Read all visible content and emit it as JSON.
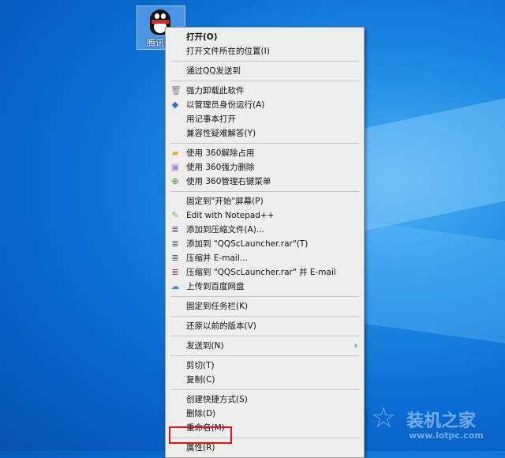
{
  "desktop": {
    "icon_label": "腾讯QQ"
  },
  "menu": {
    "groups": [
      [
        {
          "label": "打开(O)",
          "bold": true
        },
        {
          "label": "打开文件所在的位置(I)"
        }
      ],
      [
        {
          "label": "通过QQ发送到"
        }
      ],
      [
        {
          "label": "强力卸载此软件",
          "icon": "trash-icon"
        },
        {
          "label": "以管理员身份运行(A)",
          "icon": "uac-shield-icon"
        },
        {
          "label": "用记事本打开"
        },
        {
          "label": "兼容性疑难解答(Y)"
        }
      ],
      [
        {
          "label": "使用 360解除占用",
          "icon": "folder-unlock-icon"
        },
        {
          "label": "使用 360强力删除",
          "icon": "shredder-icon"
        },
        {
          "label": "使用 360管理右键菜单",
          "icon": "360-icon"
        }
      ],
      [
        {
          "label": "固定到\"开始\"屏幕(P)"
        },
        {
          "label": "Edit with Notepad++",
          "icon": "notepad-plus-plus-icon"
        },
        {
          "label": "添加到压缩文件(A)...",
          "icon": "winrar-icon"
        },
        {
          "label": "添加到 \"QQScLauncher.rar\"(T)",
          "icon": "winrar-icon"
        },
        {
          "label": "压缩并 E-mail...",
          "icon": "winrar-icon"
        },
        {
          "label": "压缩到 \"QQScLauncher.rar\" 并 E-mail",
          "icon": "winrar-icon"
        },
        {
          "label": "上传到百度网盘",
          "icon": "baidu-netdisk-icon"
        }
      ],
      [
        {
          "label": "固定到任务栏(K)"
        }
      ],
      [
        {
          "label": "还原以前的版本(V)"
        }
      ],
      [
        {
          "label": "发送到(N)",
          "submenu": true
        }
      ],
      [
        {
          "label": "剪切(T)"
        },
        {
          "label": "复制(C)"
        }
      ],
      [
        {
          "label": "创建快捷方式(S)"
        },
        {
          "label": "删除(D)"
        },
        {
          "label": "重命名(M)"
        }
      ],
      [
        {
          "label": "属性(R)",
          "highlighted": true
        }
      ]
    ]
  },
  "watermark": {
    "title": "装机之家",
    "url": "www.lotpc.com"
  },
  "colors": {
    "highlight": "#e0141e",
    "menu_bg": "#eeeeee"
  }
}
